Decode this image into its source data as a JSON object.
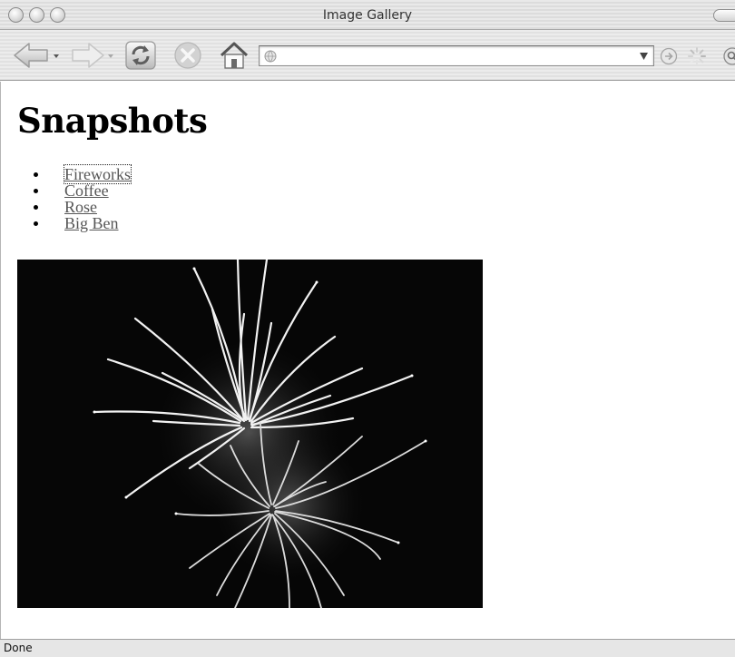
{
  "window": {
    "title": "Image Gallery"
  },
  "navbar": {
    "url_value": "",
    "url_placeholder": ""
  },
  "page": {
    "heading": "Snapshots",
    "gallery_links": [
      {
        "label": "Fireworks",
        "focused": true
      },
      {
        "label": "Coffee",
        "focused": false
      },
      {
        "label": "Rose",
        "focused": false
      },
      {
        "label": "Big Ben",
        "focused": false
      }
    ],
    "placeholder_image": "fireworks-photo"
  },
  "status": {
    "text": "Done"
  },
  "icons": {
    "back": "back-arrow-icon",
    "forward": "forward-arrow-icon",
    "reload": "reload-icon",
    "stop": "stop-icon",
    "home": "home-icon",
    "site": "site-identity-icon",
    "dropdown": "chevron-down-icon",
    "go": "go-arrow-icon",
    "loading": "loading-spinner-icon",
    "search": "search-icon"
  }
}
